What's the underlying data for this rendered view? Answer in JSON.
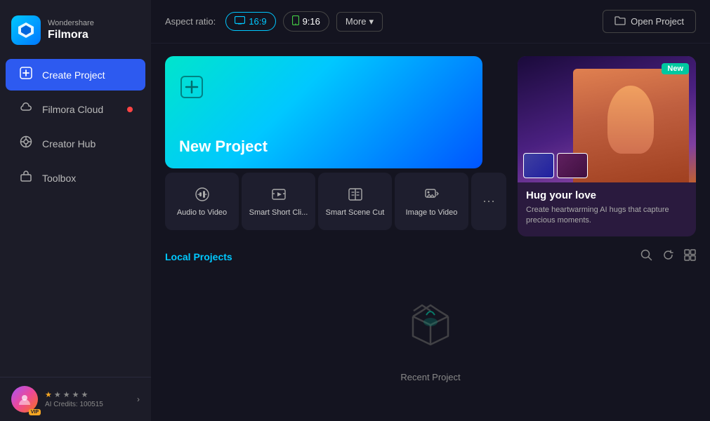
{
  "app": {
    "brand": "Wondershare",
    "name": "Filmora",
    "logo_emoji": "◆"
  },
  "sidebar": {
    "items": [
      {
        "id": "create-project",
        "label": "Create Project",
        "icon": "➕",
        "active": true
      },
      {
        "id": "filmora-cloud",
        "label": "Filmora Cloud",
        "icon": "☁",
        "active": false,
        "has_dot": true
      },
      {
        "id": "creator-hub",
        "label": "Creator Hub",
        "icon": "◎",
        "active": false
      },
      {
        "id": "toolbox",
        "label": "Toolbox",
        "icon": "⚙",
        "active": false
      }
    ]
  },
  "user": {
    "vip_label": "VIP",
    "credits_label": "AI Credits: 100515"
  },
  "topbar": {
    "aspect_ratio_label": "Aspect ratio:",
    "btn_169": "16:9",
    "btn_916": "9:16",
    "more_label": "More",
    "open_project_label": "Open Project"
  },
  "new_project": {
    "label": "New Project",
    "plus_symbol": "⊕"
  },
  "feature_cards": [
    {
      "id": "audio-to-video",
      "label": "Audio to Video",
      "icon": "🎵"
    },
    {
      "id": "smart-short-clip",
      "label": "Smart Short Cli...",
      "icon": "✂"
    },
    {
      "id": "smart-scene-cut",
      "label": "Smart Scene Cut",
      "icon": "🎬"
    },
    {
      "id": "image-to-video",
      "label": "Image to Video",
      "icon": "🖼"
    }
  ],
  "more_card": {
    "icon": "⋯"
  },
  "promo": {
    "new_badge": "New",
    "title": "Hug your love",
    "description": "Create heartwarming AI hugs that capture precious moments.",
    "dots": [
      true,
      false,
      false,
      false,
      false,
      false
    ]
  },
  "local_projects": {
    "title": "Local Projects",
    "empty_text": "Recent Project"
  },
  "icons": {
    "search": "🔍",
    "refresh": "↻",
    "grid": "⊞",
    "folder": "📁",
    "box": "📦"
  }
}
